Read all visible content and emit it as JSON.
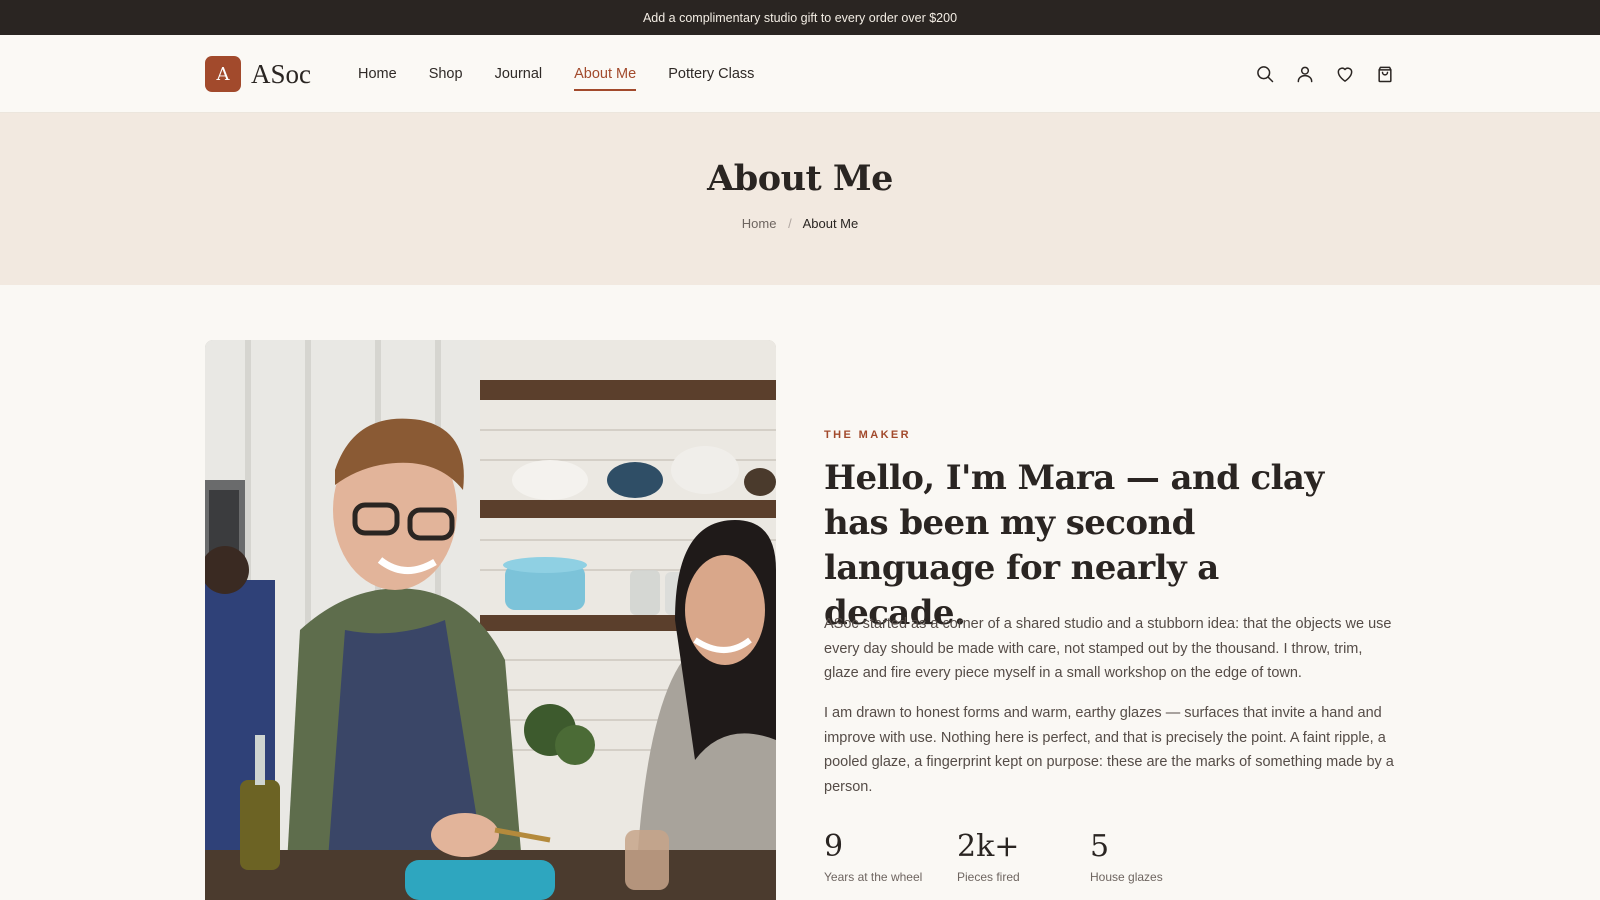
{
  "announcement": "Add a complimentary studio gift to every order over $200",
  "brand": {
    "mark": "A",
    "name": "ASoc"
  },
  "nav": {
    "items": [
      {
        "label": "Home"
      },
      {
        "label": "Shop"
      },
      {
        "label": "Journal"
      },
      {
        "label": "About Me"
      },
      {
        "label": "Pottery Class"
      }
    ],
    "active": "About Me"
  },
  "header_icons": [
    "search-icon",
    "user-icon",
    "heart-icon",
    "bag-icon"
  ],
  "hero": {
    "title": "About Me",
    "breadcrumb": {
      "home": "Home",
      "separator": "/",
      "current": "About Me"
    }
  },
  "about": {
    "eyebrow": "THE MAKER",
    "headline": "Hello, I'm Mara — and clay has been my second language for nearly a decade.",
    "paragraph1": "ASoc started as a corner of a shared studio and a stubborn idea: that the objects we use every day should be made with care, not stamped out by the thousand. I throw, trim, glaze and fire every piece myself in a small workshop on the edge of town.",
    "paragraph2": "I am drawn to honest forms and warm, earthy glazes — surfaces that invite a hand and improve with use. Nothing here is perfect, and that is precisely the point. A faint ripple, a pooled glaze, a fingerprint kept on purpose: these are the marks of something made by a person.",
    "stats": [
      {
        "value": "9",
        "label": "Years at the wheel"
      },
      {
        "value": "2k+",
        "label": "Pieces fired"
      },
      {
        "value": "5",
        "label": "House glazes"
      }
    ]
  },
  "colors": {
    "accent": "#a24a2c",
    "topbar": "#2a2522",
    "hero_bg": "#f2e9e0",
    "page_bg": "#faf8f4"
  }
}
